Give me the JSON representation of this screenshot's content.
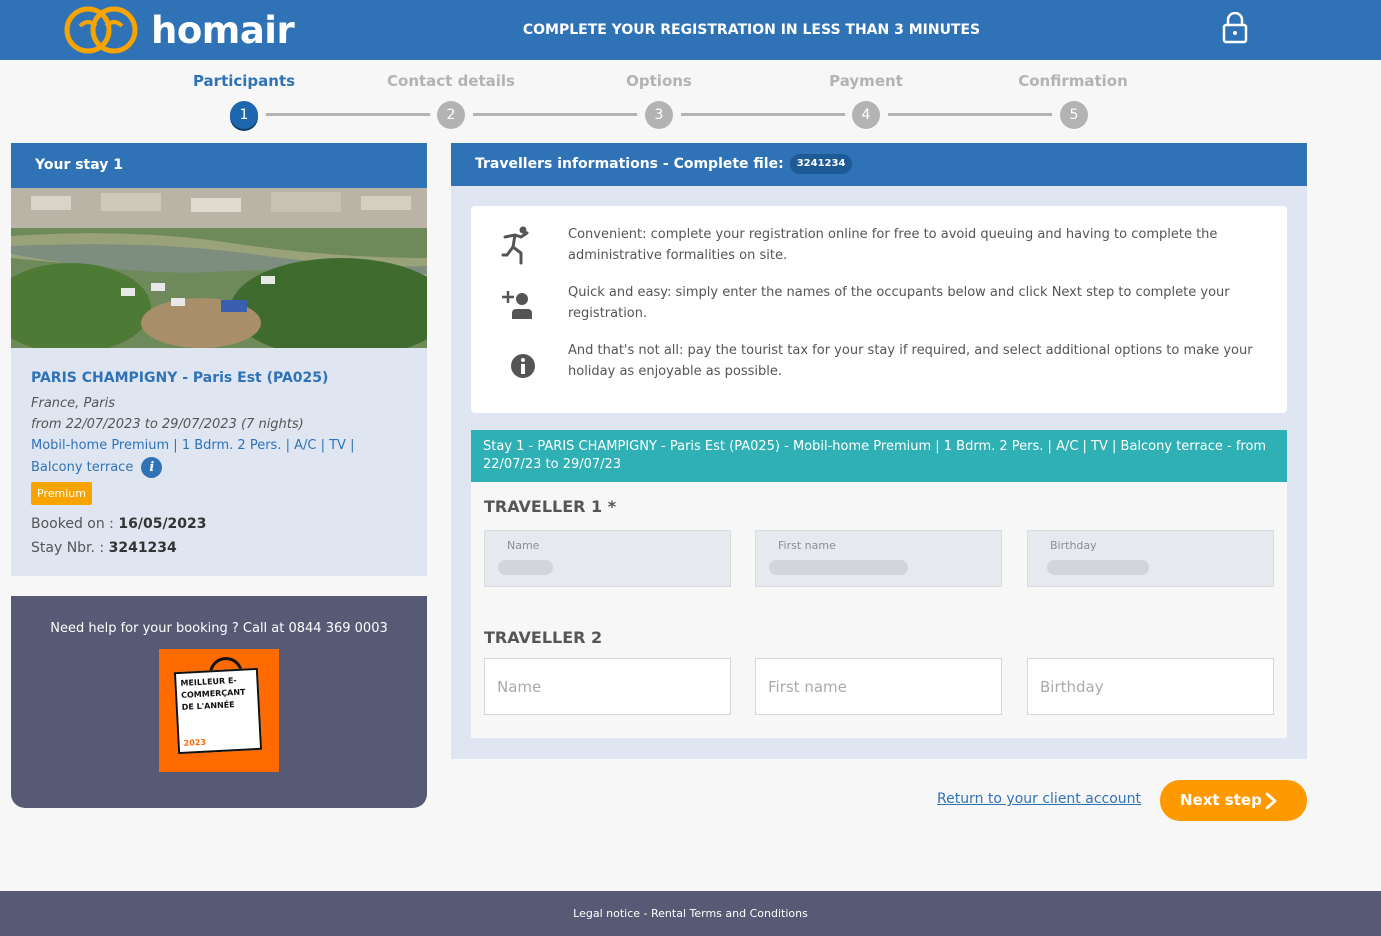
{
  "brand": {
    "name": "homair",
    "primary_color": "#2f73b6",
    "accent_color": "#ff9900",
    "logo_color": "#f7a400"
  },
  "header": {
    "title": "COMPLETE YOUR REGISTRATION IN LESS THAN 3 MINUTES",
    "lock_icon": "lock-icon"
  },
  "stepper": {
    "steps": [
      {
        "label": "Participants",
        "number": "1",
        "active": true
      },
      {
        "label": "Contact details",
        "number": "2",
        "active": false
      },
      {
        "label": "Options",
        "number": "3",
        "active": false
      },
      {
        "label": "Payment",
        "number": "4",
        "active": false
      },
      {
        "label": "Confirmation",
        "number": "5",
        "active": false
      }
    ]
  },
  "stay": {
    "heading": "Your stay 1",
    "camp_name": "PARIS CHAMPIGNY - Paris Est (PA025)",
    "location": "France, Paris",
    "dates": "from 22/07/2023 to 29/07/2023 (7 nights)",
    "accommodation_line1": "Mobil-home Premium | 1 Bdrm. 2 Pers. | A/C | TV |",
    "accommodation_line2": "Balcony terrace",
    "badge": "Premium",
    "booked_label": "Booked on :",
    "booked_value": "16/05/2023",
    "stay_nbr_label": "Stay Nbr. :",
    "stay_nbr_value": "3241234"
  },
  "help": {
    "text": "Need help for your booking ? Call at 0844 369 0003",
    "award_text": "MEILLEUR E-COMMERÇANT DE L'ANNÉE",
    "award_year": "2023"
  },
  "travellers": {
    "heading": "Travellers informations - Complete file:",
    "file_number": "3241234",
    "info": [
      {
        "icon": "running-person-icon",
        "text": "Convenient: complete your registration online for free to avoid queuing and having to complete the administrative formalities on site."
      },
      {
        "icon": "add-person-icon",
        "text": "Quick and easy: simply enter the names of the occupants below and click Next step to complete your registration."
      },
      {
        "icon": "info-icon",
        "text": "And that's not all: pay the tourist tax for your stay if required, and select additional options to make your holiday as enjoyable as possible."
      }
    ],
    "stay_banner": "Stay 1 - PARIS CHAMPIGNY - Paris Est (PA025) - Mobil-home Premium | 1 Bdrm. 2 Pers. | A/C | TV | Balcony terrace - from 22/07/23 to 29/07/23",
    "traveller1": {
      "title": "TRAVELLER 1 *",
      "name_label": "Name",
      "firstname_label": "First name",
      "birthday_label": "Birthday"
    },
    "traveller2": {
      "title": "TRAVELLER 2",
      "name_placeholder": "Name",
      "firstname_placeholder": "First name",
      "birthday_placeholder": "Birthday"
    }
  },
  "actions": {
    "return_link": "Return to your client account",
    "next_button": "Next step"
  },
  "footer": {
    "legal": "Legal notice",
    "separator": " - ",
    "terms": "Rental Terms and Conditions"
  }
}
